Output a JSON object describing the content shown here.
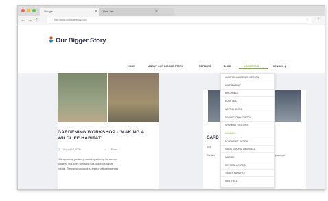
{
  "browser": {
    "tabs": [
      {
        "label": "Google"
      },
      {
        "label": "New Tab"
      }
    ],
    "url": "http://www.ourbiggerstory.com/"
  },
  "site": {
    "logo": "Our Bigger Story",
    "nav": [
      "HOME",
      "ABOUT OUR BIGGER STORY",
      "REPORTS",
      "BLOG",
      "LOCATIONS",
      "SEARCH Q"
    ],
    "active_nav": "LOCATIONS",
    "locations_menu": [
      "AMBITION LAWRENCE WESTON",
      "BARROWCLIFF",
      "BIRCHFIELD",
      "BOUNTAGU",
      "CATTON GROVE",
      "DINNINGTON HADWOOD",
      "GROWING TOGETHER",
      "HAVANELL",
      "NORTHFLEET NORTH",
      "RADSTOCK AND WESTFIELD",
      "RAMSEY",
      "REVOE BLACKPOOL",
      "TIMBER PARISHES",
      "WESTFIELD"
    ],
    "highlighted_location": "HAVANELL"
  },
  "post": {
    "title": "GARDENING WORKSHOP - 'MAKING A WILDLIFE HABITAT'.",
    "date": "August 18, 2020",
    "category": "Photo",
    "excerpt_lines": [
      "HBL is running gardening workshops during the summer",
      "holidays. This week workshop was 'Making a wildlife",
      "habitat'. The participants use a range of natural materials"
    ]
  },
  "side_post": {
    "title": "GARD",
    "meta": "Aug",
    "text": "Garden",
    "text_right": "plant pots'"
  },
  "colors": {
    "accent": "#7bb52a",
    "content_bg": "#eef0f3",
    "title_text": "#2c2c3a"
  }
}
